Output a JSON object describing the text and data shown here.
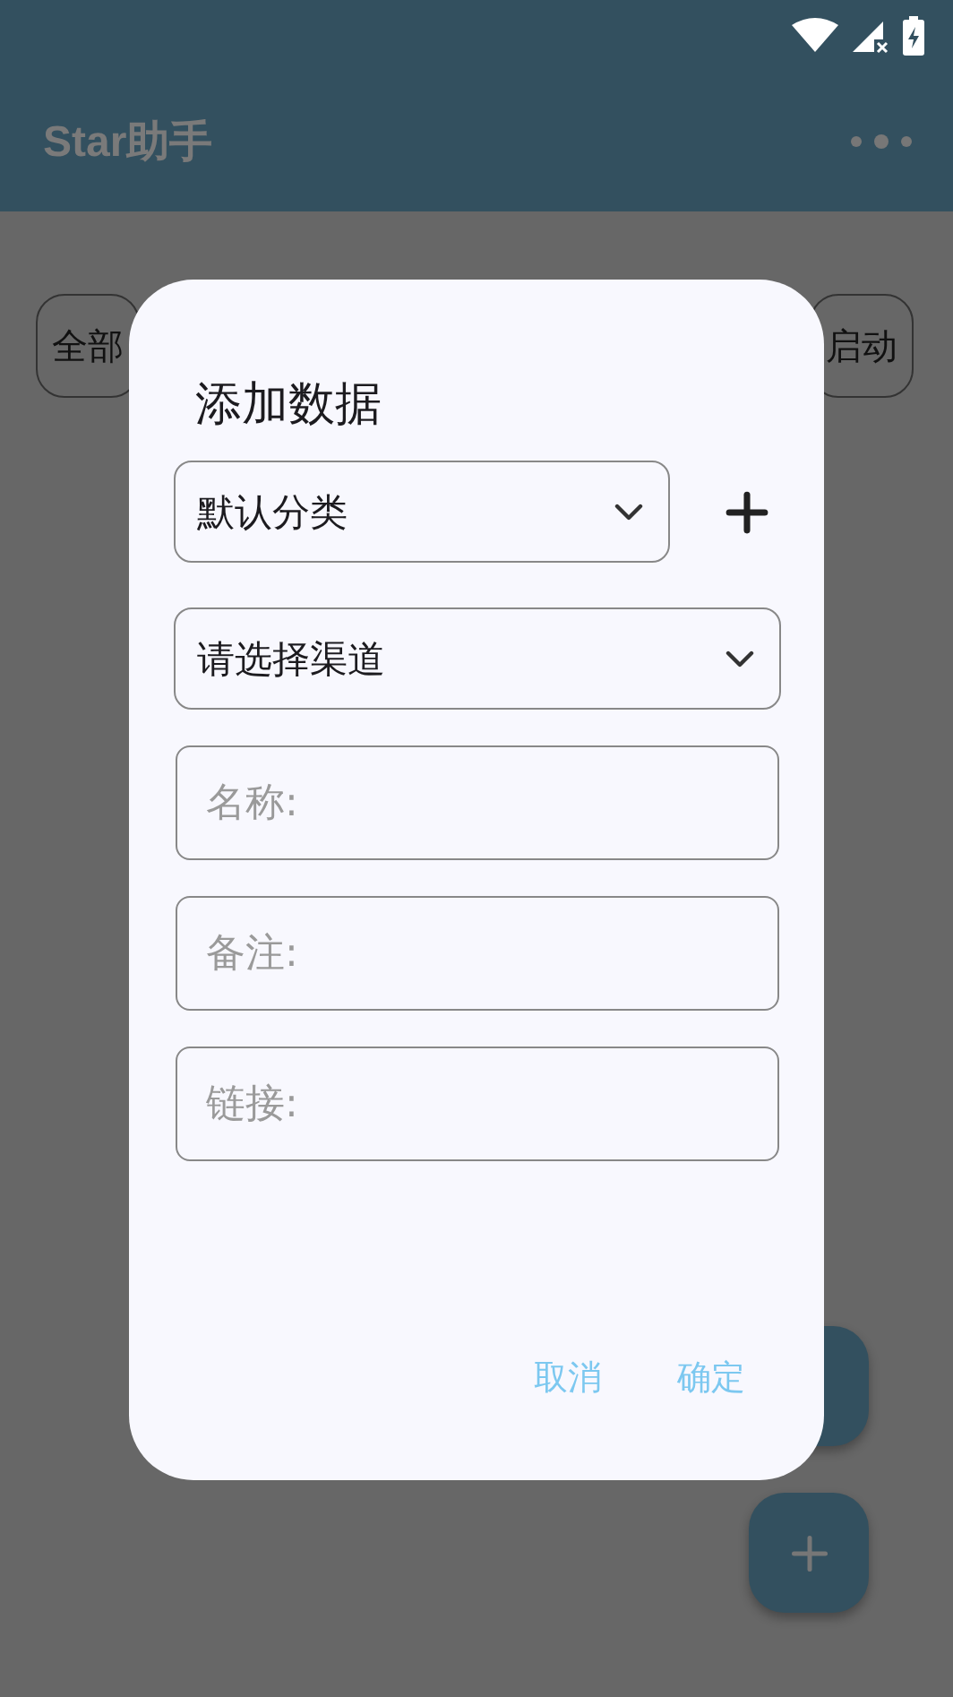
{
  "app_bar": {
    "title": "Star助手"
  },
  "chips": [
    {
      "label": "全部"
    },
    {
      "label": "启动"
    }
  ],
  "dialog": {
    "title": "添加数据",
    "category_select": {
      "value": "默认分类"
    },
    "channel_select": {
      "value": "请选择渠道"
    },
    "fields": [
      {
        "placeholder": "名称:"
      },
      {
        "placeholder": "备注:"
      },
      {
        "placeholder": "链接:"
      }
    ],
    "buttons": [
      "取消",
      "确定"
    ]
  }
}
